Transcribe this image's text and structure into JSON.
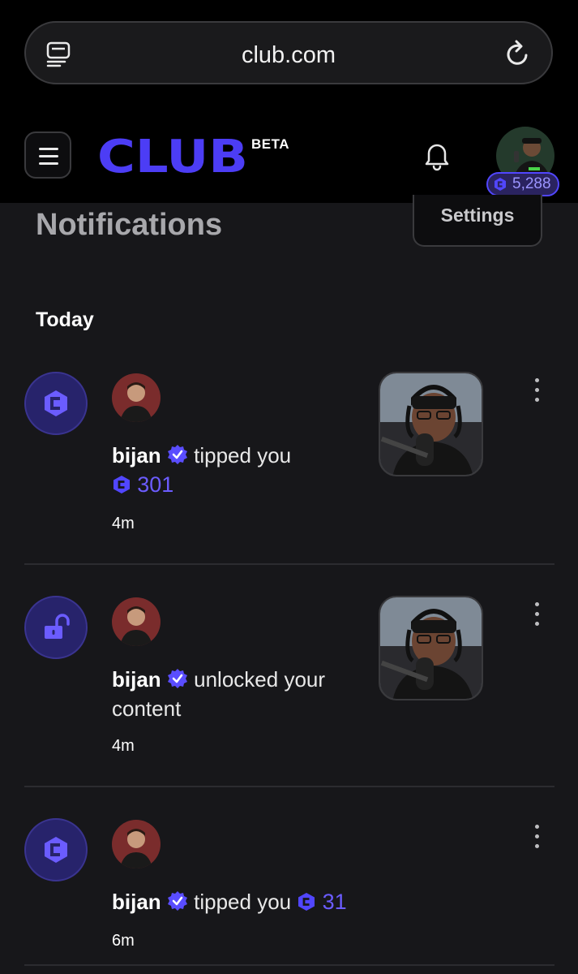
{
  "browser": {
    "url": "club.com"
  },
  "header": {
    "logo": "CLUB",
    "beta": "BETA",
    "balance": "5,288"
  },
  "page": {
    "title": "Notifications",
    "settings_label": "Settings",
    "section": "Today"
  },
  "notifications": [
    {
      "type_icon": "club-coin-icon",
      "user": "bijan",
      "action": "tipped you",
      "amount": "301",
      "time": "4m",
      "has_thumbnail": true
    },
    {
      "type_icon": "unlock-icon",
      "user": "bijan",
      "action": "unlocked your",
      "action_line2": "content",
      "time": "4m",
      "has_thumbnail": true
    },
    {
      "type_icon": "club-coin-icon",
      "user": "bijan",
      "action": "tipped you",
      "amount": "31",
      "time": "6m",
      "has_thumbnail": false
    }
  ],
  "colors": {
    "accent": "#5146ff",
    "background": "#17171a",
    "header": "#000000",
    "icon_circle": "#27236b"
  }
}
